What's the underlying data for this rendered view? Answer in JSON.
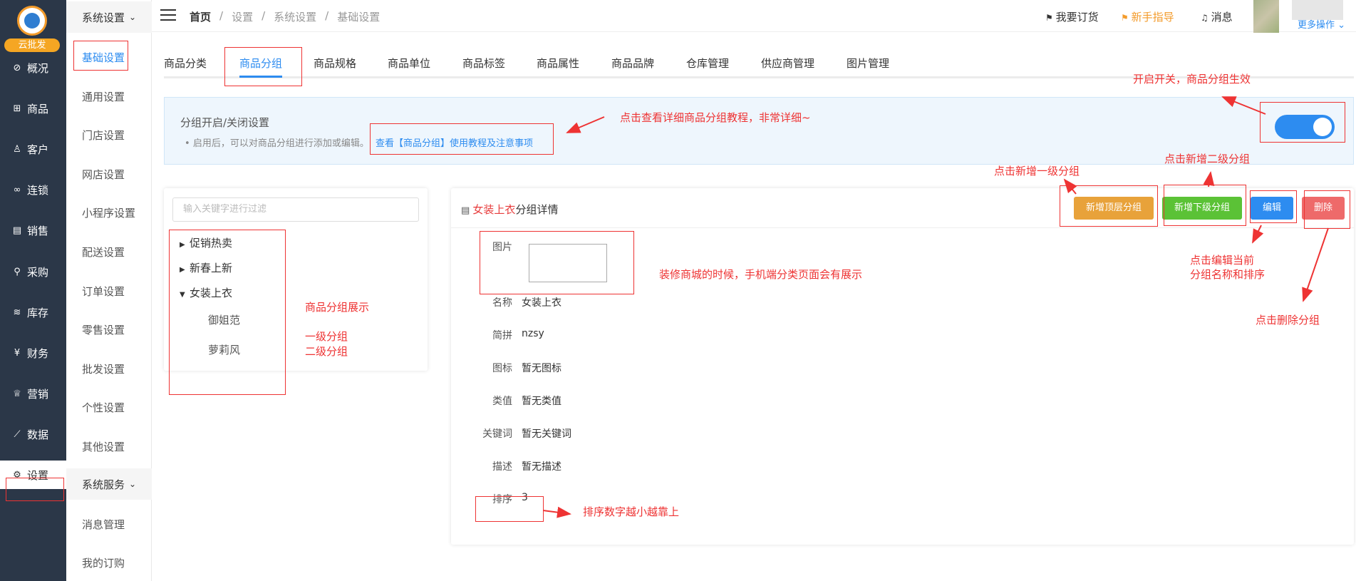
{
  "brand": {
    "badge": "云批发"
  },
  "nav1": [
    {
      "label": "概况",
      "icon": "compass-icon",
      "glyph": "⊘"
    },
    {
      "label": "商品",
      "icon": "grid-icon",
      "glyph": "⊞"
    },
    {
      "label": "客户",
      "icon": "user-icon",
      "glyph": "♙"
    },
    {
      "label": "连锁",
      "icon": "link-icon",
      "glyph": "∞"
    },
    {
      "label": "销售",
      "icon": "clipboard-icon",
      "glyph": "▤"
    },
    {
      "label": "采购",
      "icon": "purchase-icon",
      "glyph": "⚲"
    },
    {
      "label": "库存",
      "icon": "stack-icon",
      "glyph": "≋"
    },
    {
      "label": "财务",
      "icon": "yen-icon",
      "glyph": "¥"
    },
    {
      "label": "营销",
      "icon": "crown-icon",
      "glyph": "♕"
    },
    {
      "label": "数据",
      "icon": "chart-icon",
      "glyph": "⟋"
    },
    {
      "label": "设置",
      "icon": "gear-icon",
      "glyph": "⚙"
    }
  ],
  "side2": {
    "group1": "系统设置",
    "items1": [
      "基础设置",
      "通用设置",
      "门店设置",
      "网店设置",
      "小程序设置",
      "配送设置",
      "订单设置",
      "零售设置",
      "批发设置",
      "个性设置",
      "其他设置"
    ],
    "group2": "系统服务",
    "items2": [
      "消息管理",
      "我的订购"
    ]
  },
  "topbar": {
    "breadcrumb": [
      "首页",
      "/",
      "设置",
      "/",
      "系统设置",
      "/",
      "基础设置"
    ],
    "order": "我要订货",
    "guide": "新手指导",
    "message": "消息",
    "more": "更多操作"
  },
  "tabs": [
    "商品分类",
    "商品分组",
    "商品规格",
    "商品单位",
    "商品标签",
    "商品属性",
    "商品品牌",
    "仓库管理",
    "供应商管理",
    "图片管理"
  ],
  "info": {
    "title": "分组开启/关闭设置",
    "bullet": "启用后，可以对商品分组进行添加或编辑。",
    "link": "查看【商品分组】使用教程及注意事项",
    "toggle_on": true
  },
  "tree": {
    "placeholder": "输入关键字进行过滤",
    "nodes": [
      {
        "label": "促销热卖",
        "arrow": "▶"
      },
      {
        "label": "新春上新",
        "arrow": "▶"
      },
      {
        "label": "女装上衣",
        "arrow": "▼"
      }
    ],
    "children": [
      "御姐范",
      "萝莉风"
    ]
  },
  "detail": {
    "title_hl": "女装上衣",
    "title_rest": "分组详情",
    "buttons": {
      "add_top": "新增顶层分组",
      "add_sub": "新增下级分组",
      "edit": "编辑",
      "delete": "删除"
    },
    "rows": [
      {
        "label": "图片",
        "value": ""
      },
      {
        "label": "名称",
        "value": "女装上衣"
      },
      {
        "label": "简拼",
        "value": "nzsy"
      },
      {
        "label": "图标",
        "value": "暂无图标"
      },
      {
        "label": "类值",
        "value": "暂无类值"
      },
      {
        "label": "关键词",
        "value": "暂无关键词"
      },
      {
        "label": "描述",
        "value": "暂无描述"
      },
      {
        "label": "排序",
        "value": "3"
      }
    ]
  },
  "annotations": {
    "toggle": "开启开关，商品分组生效",
    "tutorial": "点击查看详细商品分组教程，非常详细~",
    "add_top": "点击新增一级分组",
    "add_sub": "点击新增二级分组",
    "edit_l1": "点击编辑当前",
    "edit_l2": "分组名称和排序",
    "delete": "点击删除分组",
    "image": "装修商城的时候，手机端分类页面会有展示",
    "tree_title": "商品分组展示",
    "tree_l1": "一级分组",
    "tree_l2": "二级分组",
    "sort": "排序数字越小越靠上"
  }
}
